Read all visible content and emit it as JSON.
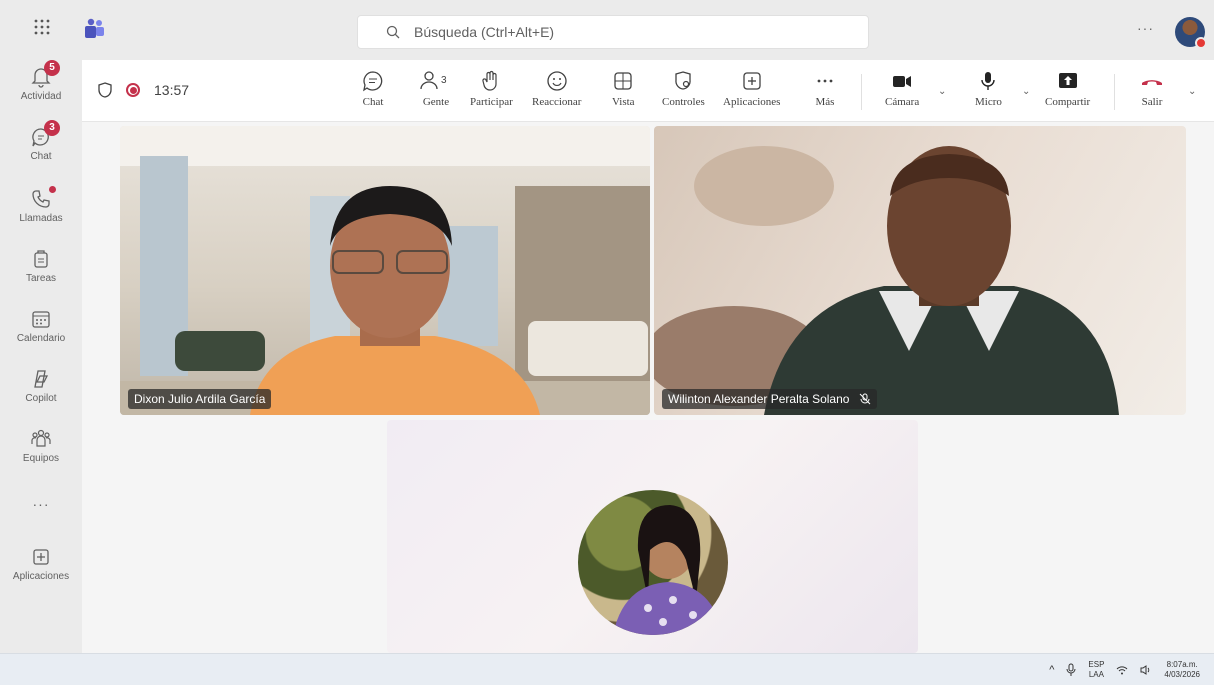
{
  "topbar": {
    "search_placeholder": "Búsqueda (Ctrl+Alt+E)",
    "more": "···"
  },
  "rail": {
    "items": [
      {
        "label": "Actividad",
        "badge": "5",
        "icon": "bell-icon"
      },
      {
        "label": "Chat",
        "badge": "3",
        "icon": "chat-icon"
      },
      {
        "label": "Llamadas",
        "icon": "phone-icon"
      },
      {
        "label": "Tareas",
        "icon": "tasks-icon"
      },
      {
        "label": "Calendario",
        "icon": "calendar-icon"
      },
      {
        "label": "Copilot",
        "icon": "copilot-icon"
      },
      {
        "label": "Equipos",
        "icon": "teams-icon"
      },
      {
        "label": "···",
        "icon": "more-icon"
      },
      {
        "label": "Aplicaciones",
        "icon": "apps-icon"
      }
    ]
  },
  "meeting": {
    "timer": "13:57",
    "people_count": "3",
    "tools": {
      "chat": "Chat",
      "people": "Gente",
      "raise": "Participar",
      "react": "Reaccionar",
      "view": "Vista",
      "controls": "Controles",
      "apps": "Aplicaciones",
      "more": "Más",
      "camera": "Cámara",
      "mic": "Micro",
      "share": "Compartir",
      "leave": "Salir"
    }
  },
  "participants": [
    {
      "name": "Dixon Julio Ardila García"
    },
    {
      "name": "Wilinton Alexander Peralta Solano"
    }
  ],
  "taskbar": {
    "lang1": "ESP",
    "lang2": "LAA",
    "time": "8:07a.m.",
    "date": "4/03/2026"
  },
  "colors": {
    "accent": "#5b5fc7",
    "badge": "#c4314b",
    "leave": "#c4314b"
  }
}
